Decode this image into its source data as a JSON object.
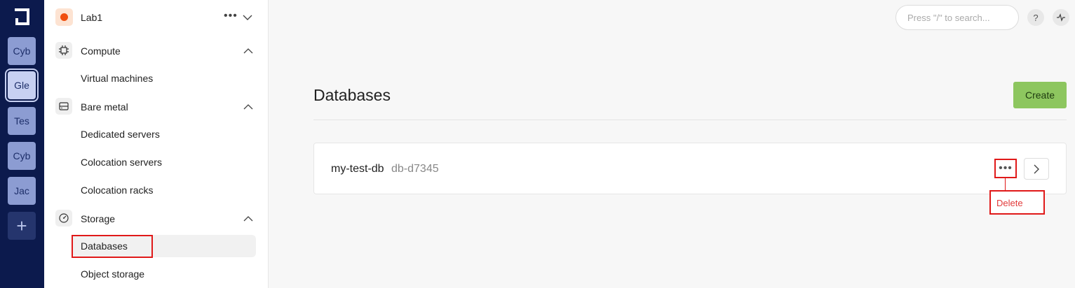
{
  "rail": {
    "workspaces": [
      {
        "label": "Cyb"
      },
      {
        "label": "Gle"
      },
      {
        "label": "Tes"
      },
      {
        "label": "Cyb"
      },
      {
        "label": "Jac"
      }
    ],
    "add_label": "+"
  },
  "sidebar": {
    "org_name": "Lab1",
    "org_more": "•••",
    "sections": [
      {
        "label": "Compute",
        "items": [
          {
            "label": "Virtual machines"
          }
        ]
      },
      {
        "label": "Bare metal",
        "items": [
          {
            "label": "Dedicated servers"
          },
          {
            "label": "Colocation servers"
          },
          {
            "label": "Colocation racks"
          }
        ]
      },
      {
        "label": "Storage",
        "items": [
          {
            "label": "Databases"
          },
          {
            "label": "Object storage"
          }
        ]
      }
    ]
  },
  "header": {
    "search_placeholder": "Press \"/\" to search...",
    "help": "?"
  },
  "main": {
    "title": "Databases",
    "create_label": "Create",
    "databases": [
      {
        "name": "my-test-db",
        "id": "db-d7345"
      }
    ],
    "more_label": "•••",
    "menu": {
      "delete_label": "Delete"
    }
  },
  "colors": {
    "rail_bg": "#0c1a4d",
    "create_bg": "#8dc65f",
    "org_dot": "#f04f0f",
    "highlight": "#e01919"
  }
}
